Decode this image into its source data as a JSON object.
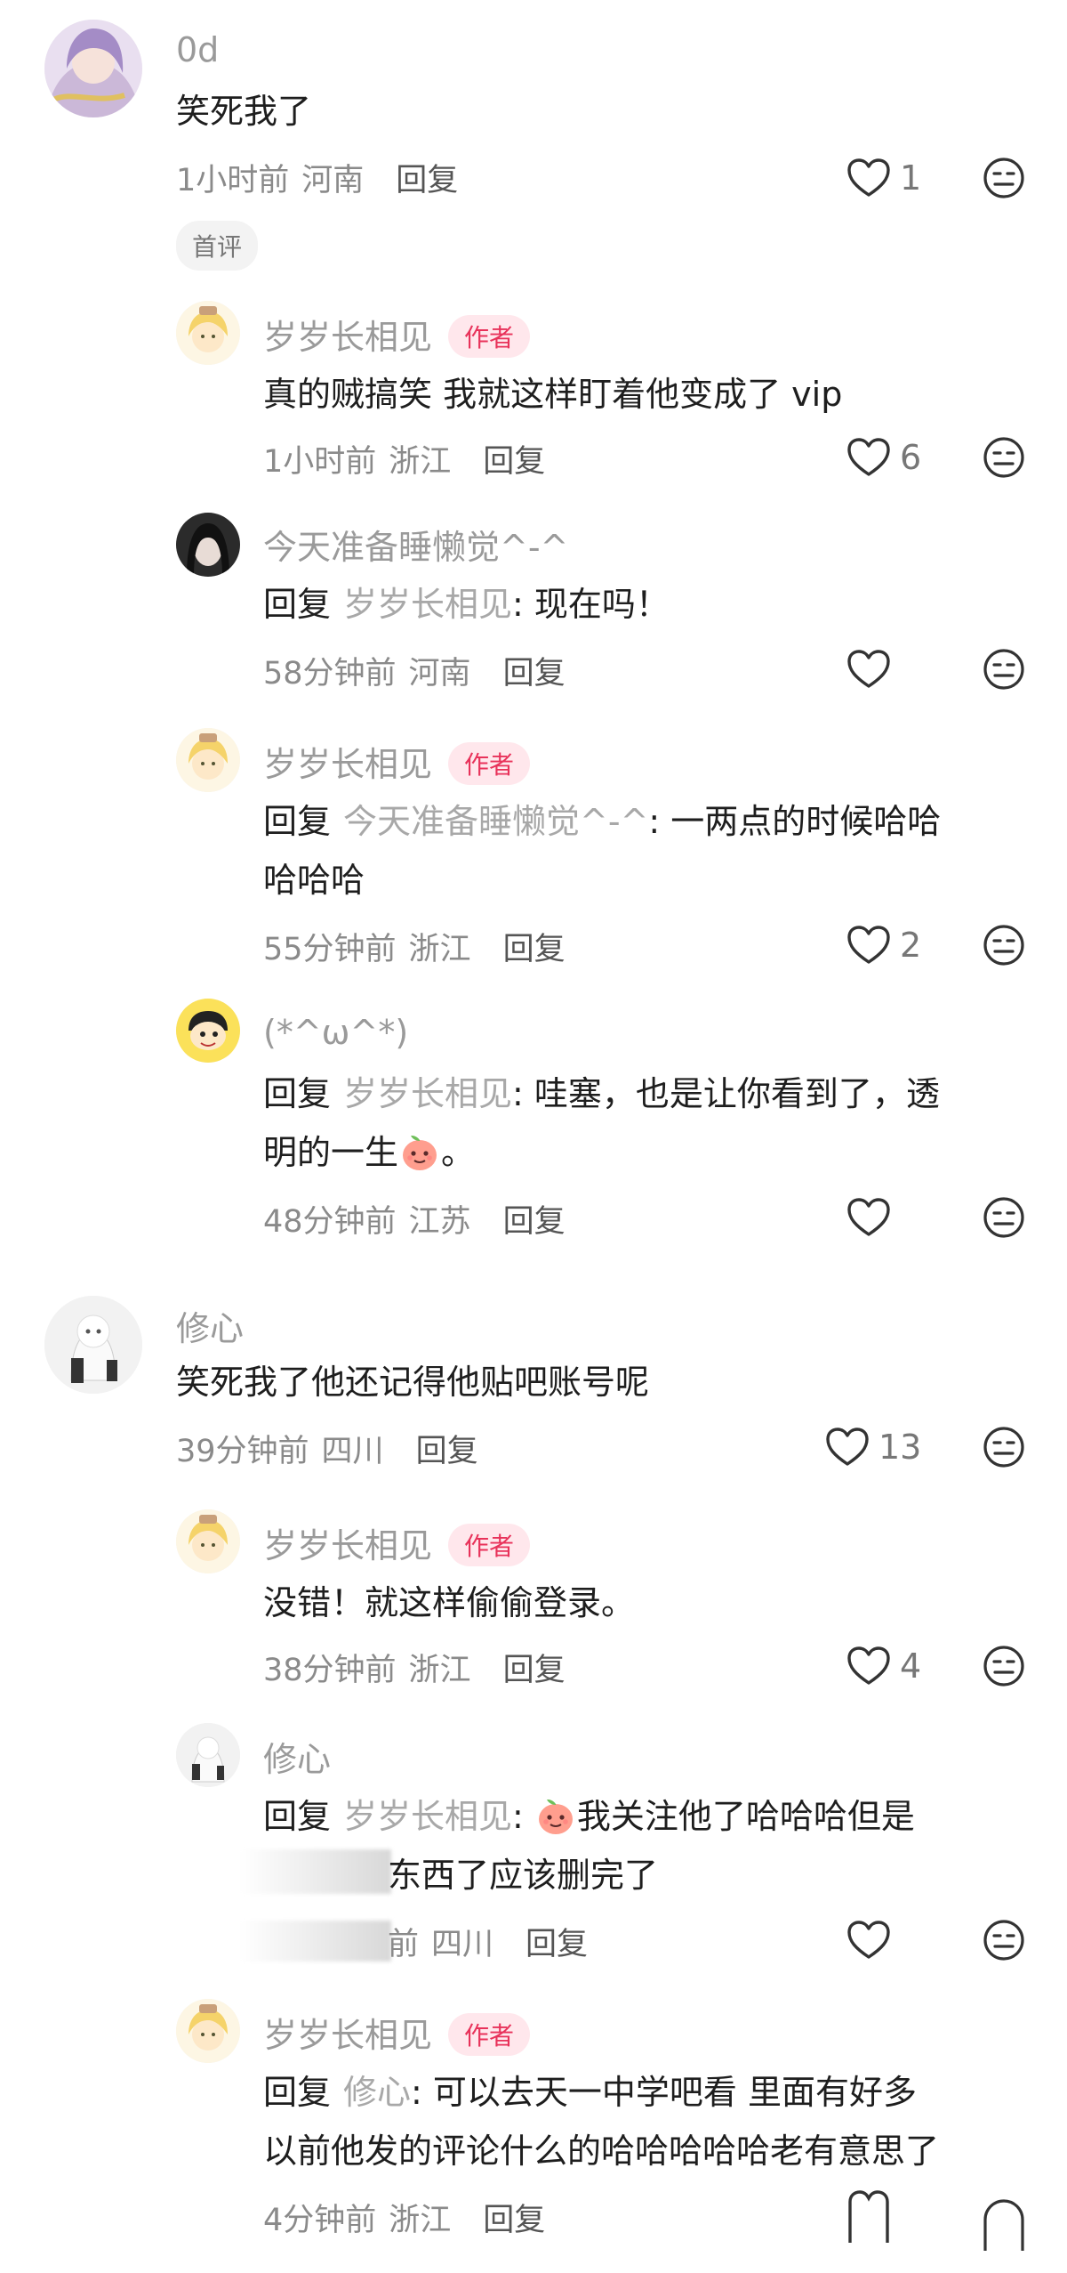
{
  "comments": [
    {
      "name": "0d",
      "text": "笑死我了",
      "time": "1小时前",
      "location": "河南",
      "reply_label": "回复",
      "likes": "1",
      "tag": "首评"
    },
    {
      "name": "岁岁长相见",
      "badge": "作者",
      "text": "真的贼搞笑 我就这样盯着他变成了 vip",
      "time": "1小时前",
      "location": "浙江",
      "reply_label": "回复",
      "likes": "6"
    },
    {
      "name": "今天准备睡懒觉^-^",
      "reply_prefix": "回复",
      "reply_to": "岁岁长相见",
      "text": ": 现在吗！",
      "time": "58分钟前",
      "location": "河南",
      "reply_label": "回复",
      "likes": ""
    },
    {
      "name": "岁岁长相见",
      "badge": "作者",
      "reply_prefix": "回复",
      "reply_to": "今天准备睡懒觉^-^",
      "text_line1": ": 一两点的时候哈哈",
      "text_line2": "哈哈哈",
      "time": "55分钟前",
      "location": "浙江",
      "reply_label": "回复",
      "likes": "2"
    },
    {
      "name": "(*^ω^*)",
      "reply_prefix": "回复",
      "reply_to": "岁岁长相见",
      "text_line1": ": 哇塞，也是让你看到了，透",
      "text_line2_a": "明的一生",
      "text_line2_b": "。",
      "time": "48分钟前",
      "location": "江苏",
      "reply_label": "回复",
      "likes": ""
    },
    {
      "name": "修心",
      "text": "笑死我了他还记得他贴吧账号呢",
      "time": "39分钟前",
      "location": "四川",
      "reply_label": "回复",
      "likes": "13"
    },
    {
      "name": "岁岁长相见",
      "badge": "作者",
      "text": "没错！就这样偷偷登录。",
      "time": "38分钟前",
      "location": "浙江",
      "reply_label": "回复",
      "likes": "4"
    },
    {
      "name": "修心",
      "reply_prefix": "回复",
      "reply_to": "岁岁长相见",
      "text_line1": "我关注他了哈哈哈但是",
      "text_line2": "东西了应该删完了",
      "time": "前",
      "location": "四川",
      "reply_label": "回复",
      "likes": ""
    },
    {
      "name": "岁岁长相见",
      "badge": "作者",
      "reply_prefix": "回复",
      "reply_to": "修心",
      "text_line1": ": 可以去天一中学吧看 里面有好多",
      "text_line2": "以前他发的评论什么的哈哈哈哈哈老有意思了",
      "time": "4分钟前",
      "location": "浙江",
      "reply_label": "回复"
    }
  ],
  "colors": {
    "author_badge_bg": "#ffe7ec",
    "author_badge_text": "#e8325a",
    "muted": "#9a9a9a"
  },
  "icons": [
    "heart-outline-icon",
    "dislike-face-icon",
    "peach-emoji-icon"
  ]
}
